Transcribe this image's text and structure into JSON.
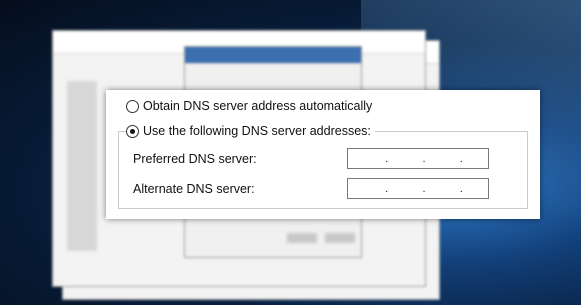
{
  "dialog": {
    "obtain_auto_label": "Obtain DNS server address automatically",
    "use_following_label": "Use the following DNS server addresses:",
    "preferred_label": "Preferred DNS server:",
    "alternate_label": "Alternate DNS server:",
    "selected_option": "use_following"
  },
  "preferred_ip": {
    "dots": [
      ".",
      ".",
      "."
    ]
  },
  "alternate_ip": {
    "dots": [
      ".",
      ".",
      "."
    ]
  }
}
